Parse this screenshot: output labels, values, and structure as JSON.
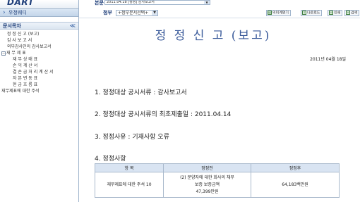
{
  "left": {
    "logo": "DART",
    "search_label": "우정웨디",
    "toc_title": "문서목차",
    "toc_collapse": "≪",
    "tree": [
      {
        "label": "정 정 신 고 (보고)",
        "level": 0
      },
      {
        "label": "감 사 보 고 서",
        "level": 0
      },
      {
        "label": "외부감사인의 감사보고서",
        "level": 0
      },
      {
        "label": "재 무 제 표",
        "level": -1,
        "expanded": true
      },
      {
        "label": "재 무 상 태 표",
        "level": 1
      },
      {
        "label": "손 익 계 산 서",
        "level": 1
      },
      {
        "label": "결 손 금 처 리 계 산 서",
        "level": 1
      },
      {
        "label": "자 본 변 동 표",
        "level": 1
      },
      {
        "label": "현 금 흐 름 표",
        "level": 1
      },
      {
        "label": "재무제표에 대한 주석",
        "level": 0
      }
    ]
  },
  "topbar": {
    "label": "본문",
    "selected": "2011.04.18 [정정] 감사보고서"
  },
  "attbar": {
    "label": "첨부",
    "selected": "+첨부문서선택+",
    "tools": [
      "의미계연기",
      "다운로드",
      "인쇄",
      "검색"
    ]
  },
  "doc": {
    "title": "정 정 신 고 (보고)",
    "date": "2011년 04월 18일",
    "sections": [
      "1. 정정대상 공시서류 : 감사보고서",
      "2. 정정대상 공시서류의 최초제출일 : 2011.04.14",
      "3. 정정사유 : 기재사항 오류",
      "4. 정정사항"
    ],
    "table": {
      "headers": [
        "항 목",
        "정정전",
        "정정후"
      ],
      "row": {
        "item": "재무제표에 대한 주석 10",
        "before_1": "(2) 분양자에 대한 회사의 채무",
        "before_2": "보증 보증금액",
        "before_3": "47,399만원",
        "after": "64,183백만원"
      }
    }
  }
}
